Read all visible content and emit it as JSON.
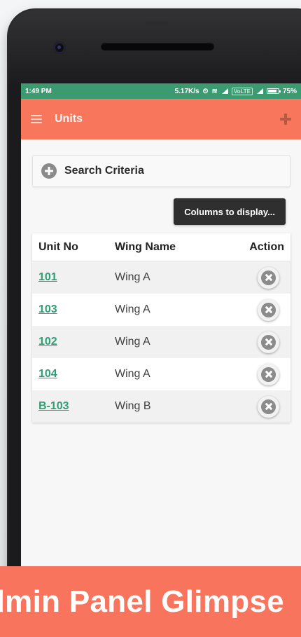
{
  "statusbar": {
    "time": "1:49 PM",
    "speed": "5.17K/s",
    "volte": "VoLTE",
    "battery": "75%"
  },
  "appbar": {
    "title": "Units",
    "menu_icon": "hamburger-menu-icon",
    "add_icon": "plus-icon"
  },
  "search": {
    "label": "Search Criteria",
    "icon": "plus-circle-icon"
  },
  "columns_button": {
    "label": "Columns to display..."
  },
  "table": {
    "headers": {
      "unit": "Unit No",
      "wing": "Wing Name",
      "action": "Action"
    },
    "rows": [
      {
        "unit": "101",
        "wing": "Wing A"
      },
      {
        "unit": "103",
        "wing": "Wing A"
      },
      {
        "unit": "102",
        "wing": "Wing A"
      },
      {
        "unit": "104",
        "wing": "Wing A"
      },
      {
        "unit": "B-103",
        "wing": "Wing B"
      }
    ]
  },
  "banner": {
    "text": "dmin Panel Glimpse"
  },
  "colors": {
    "appbar": "#f8765c",
    "statusbar": "#3b9a6f",
    "link": "#2e9e73",
    "banner": "#f9745d"
  }
}
